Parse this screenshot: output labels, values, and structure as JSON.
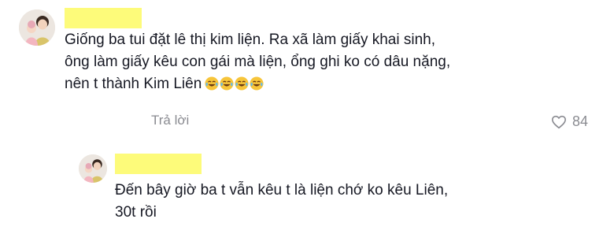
{
  "comments": [
    {
      "author_redacted": true,
      "text": "Giống ba tui đặt lê thị kim liện. Ra xã làm giấy khai sinh,\nông làm giấy kêu con gái mà liện, ổng ghi ko có dâu nặng,\nnên t thành Kim Liên",
      "emoji": [
        "face-with-tears-of-joy",
        "face-with-tears-of-joy",
        "face-with-tears-of-joy",
        "face-with-tears-of-joy"
      ],
      "reply_label": "Trả lời",
      "like_count": "84",
      "like_icon": "heart-outline-icon"
    }
  ],
  "replies": [
    {
      "author_redacted": true,
      "text": "Đến bây giờ ba t vẫn kêu t là liện chớ ko kêu Liên,\n30t rồi"
    }
  ],
  "colors": {
    "redaction": "#fdfb7a",
    "text": "#161823",
    "secondary": "#8a8b91"
  }
}
